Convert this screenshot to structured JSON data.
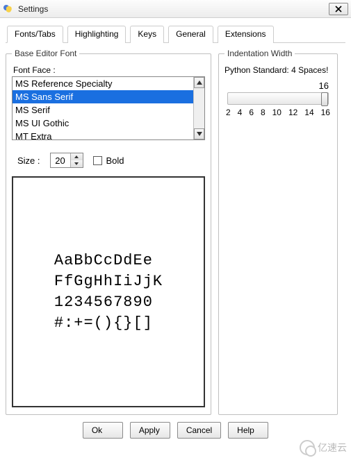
{
  "window": {
    "title": "Settings"
  },
  "tabs": {
    "items": [
      {
        "label": "Fonts/Tabs",
        "active": true
      },
      {
        "label": "Highlighting"
      },
      {
        "label": "Keys"
      },
      {
        "label": "General"
      },
      {
        "label": "Extensions"
      }
    ]
  },
  "base_font": {
    "legend": "Base Editor Font",
    "face_label": "Font Face :",
    "list": [
      {
        "name": "MS Reference Specialty"
      },
      {
        "name": "MS Sans Serif",
        "selected": true
      },
      {
        "name": "MS Serif"
      },
      {
        "name": "MS UI Gothic"
      },
      {
        "name": "MT Extra"
      }
    ],
    "size_label": "Size :",
    "size_value": "20",
    "bold_label": "Bold",
    "bold_checked": false,
    "preview_lines": {
      "l1": "AaBbCcDdEe",
      "l2": "FfGgHhIiJjK",
      "l3": "1234567890",
      "l4": "#:+=(){}[]"
    }
  },
  "indent": {
    "legend": "Indentation Width",
    "info": "Python Standard: 4 Spaces!",
    "value": "16",
    "ticks": {
      "t0": "2",
      "t1": "4",
      "t2": "6",
      "t3": "8",
      "t4": "10",
      "t5": "12",
      "t6": "14",
      "t7": "16"
    }
  },
  "buttons": {
    "ok": "Ok",
    "apply": "Apply",
    "cancel": "Cancel",
    "help": "Help"
  },
  "watermark": "亿速云"
}
